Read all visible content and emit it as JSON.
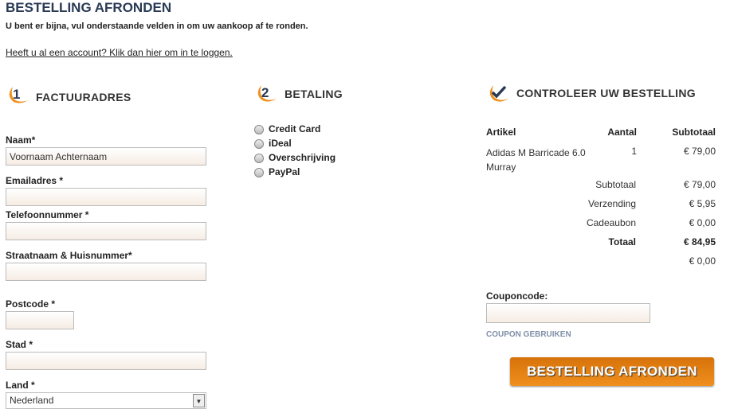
{
  "title": "BESTELLING AFRONDEN",
  "intro": "U bent er bijna, vul onderstaande velden in om uw aankoop af te ronden.",
  "login_link": "Heeft u al een account? Klik dan hier om in te loggen.",
  "billing": {
    "step": "1",
    "title": "FACTUURADRES",
    "fields": [
      {
        "label": "Naam*",
        "value": "Voornaam Achternaam"
      },
      {
        "label": "Emailadres *",
        "value": ""
      },
      {
        "label": "Telefoonnummer *",
        "value": ""
      },
      {
        "label": "Straatnaam & Huisnummer*",
        "value": ""
      },
      {
        "label": "Postcode *",
        "value": ""
      },
      {
        "label": "Stad *",
        "value": ""
      },
      {
        "label": "Land *",
        "value": "Nederland"
      }
    ]
  },
  "payment": {
    "step": "2",
    "title": "BETALING",
    "options": [
      "Credit Card",
      "iDeal",
      "Overschrijving",
      "PayPal"
    ]
  },
  "review": {
    "title": "CONTROLEER UW BESTELLING",
    "headers": [
      "Artikel",
      "Aantal",
      "Subtotaal"
    ],
    "items": [
      {
        "name": "Adidas M Barricade 6.0 Murray",
        "qty": "1",
        "subtotal": "€ 79,00"
      }
    ],
    "totals": [
      {
        "label": "Subtotaal",
        "value": "€ 79,00"
      },
      {
        "label": "Verzending",
        "value": "€ 5,95"
      },
      {
        "label": "Cadeaubon",
        "value": "€ 0,00"
      },
      {
        "label": "Totaal",
        "value": "€ 84,95"
      },
      {
        "label": "",
        "value": "€ 0,00"
      }
    ],
    "coupon_label": "Couponcode:",
    "coupon_value": "",
    "coupon_button": "COUPON GEBRUIKEN",
    "submit": "BESTELLING AFRONDEN"
  },
  "colors": {
    "accent": "#e8860f",
    "heading": "#2a3a55"
  }
}
